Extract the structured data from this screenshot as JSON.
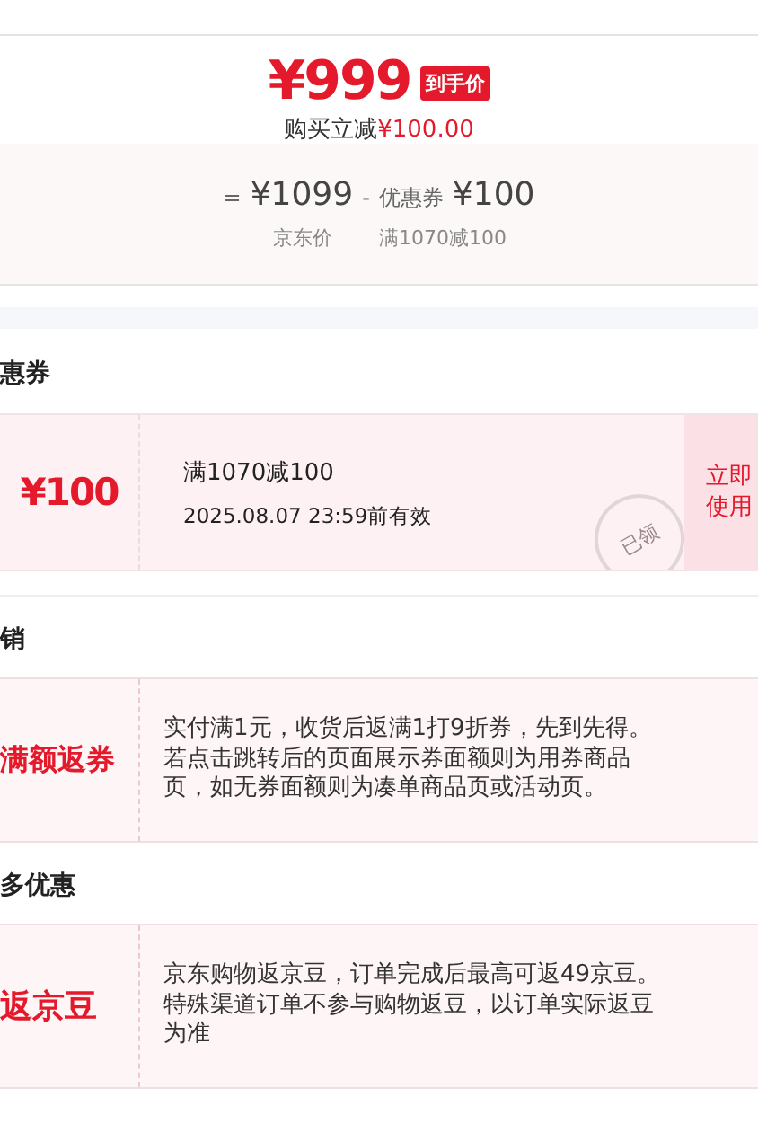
{
  "price": {
    "amount": "¥999",
    "badge": "到手价",
    "saving_label": "购买立减",
    "saving_amount": "¥100.00"
  },
  "breakdown": {
    "equals": "=",
    "base_price": "¥1099",
    "minus": "-",
    "coupon_label": "优惠券",
    "coupon_value": "¥100",
    "base_caption": "京东价",
    "coupon_caption": "满1070减100"
  },
  "sections": [
    {
      "kind": "coupon",
      "title": "惠券",
      "value": "¥100",
      "condition": "满1070减100",
      "validity": "2025.08.07 23:59前有效",
      "stamp": "已领",
      "action": "立即使用"
    },
    {
      "kind": "promo",
      "title": "销",
      "label": "满额返券",
      "description": "实付满1元，收货后返满1打9折券，先到先得。若点击跳转后的页面展示券面额则为用券商品页，如无券面额则为凑单商品页或活动页。"
    },
    {
      "kind": "promo",
      "title": "多优惠",
      "label": "返京豆",
      "description": "京东购物返京豆，订单完成后最高可返49京豆。特殊渠道订单不参与购物返豆，以订单实际返豆为准"
    }
  ]
}
